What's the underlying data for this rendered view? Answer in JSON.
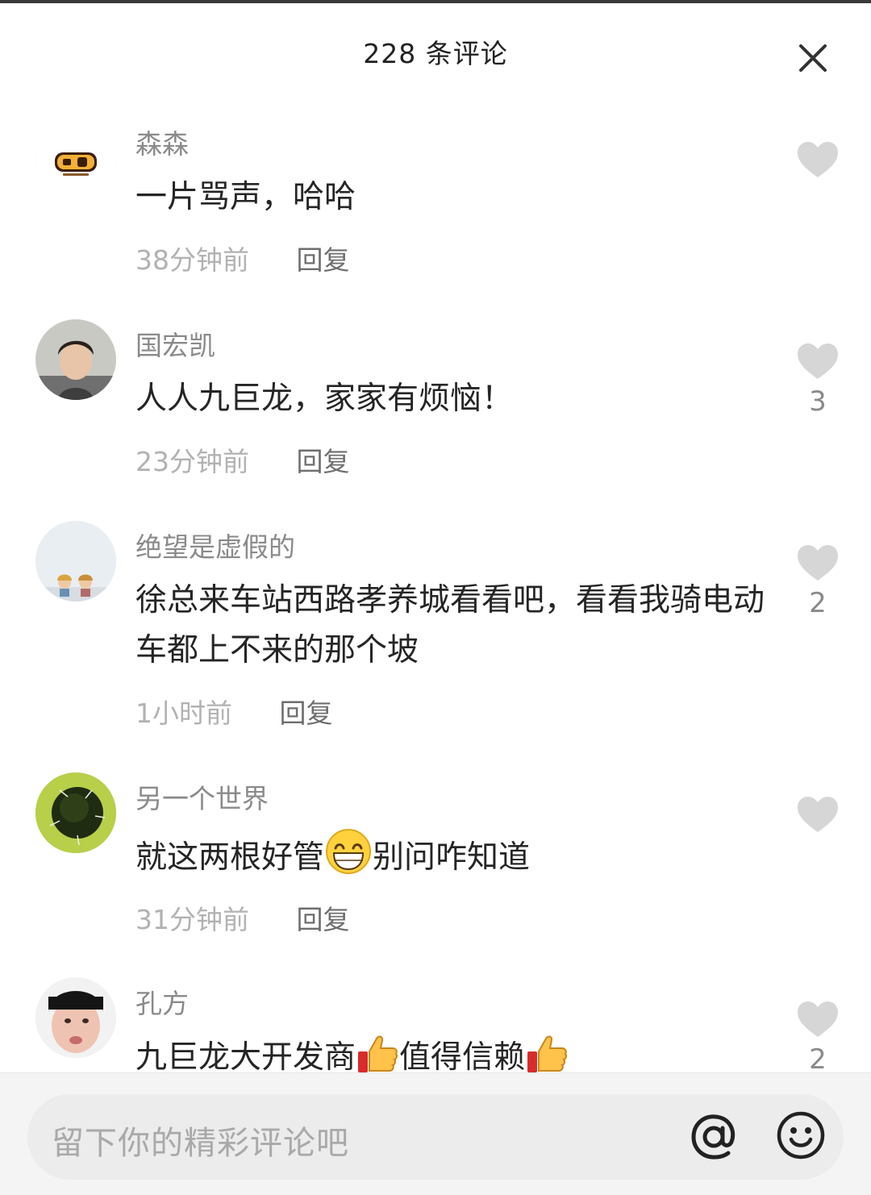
{
  "header": {
    "title": "228 条评论",
    "close_icon": "close-icon"
  },
  "comments": [
    {
      "username": "森森",
      "text": "一片骂声，哈哈",
      "time": "38分钟前",
      "reply": "回复",
      "likes": ""
    },
    {
      "username": "国宏凯",
      "text": "人人九巨龙，家家有烦恼！",
      "time": "23分钟前",
      "reply": "回复",
      "likes": "3"
    },
    {
      "username": "绝望是虚假的",
      "text": "徐总来车站西路孝养城看看吧，看看我骑电动车都上不来的那个坡",
      "time": "1小时前",
      "reply": "回复",
      "likes": "2"
    },
    {
      "username": "另一个世界",
      "text_part1": "就这两根好管",
      "text_part2": "别问咋知道",
      "time": "31分钟前",
      "reply": "回复",
      "likes": ""
    },
    {
      "username": "孔方",
      "text_part1": "九巨龙大开发商",
      "text_part2": "值得信赖",
      "likes": "2"
    }
  ],
  "input": {
    "placeholder": "留下你的精彩评论吧"
  },
  "colors": {
    "like_heart": "#d6d6d6",
    "username": "#8a8a8a",
    "time": "#b2b2b2"
  }
}
